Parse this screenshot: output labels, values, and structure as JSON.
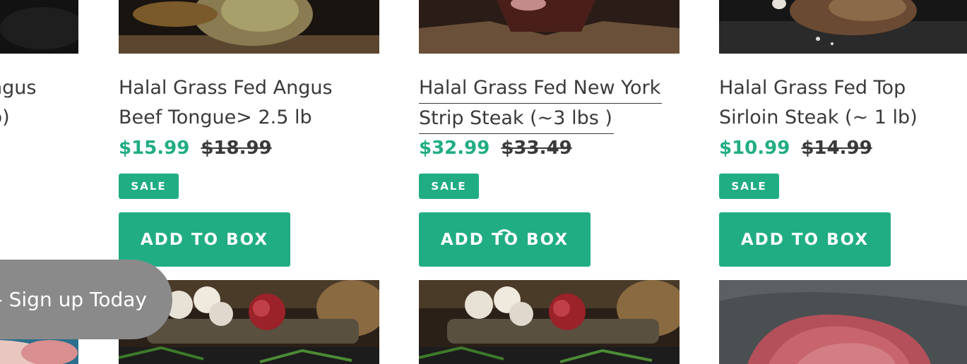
{
  "partial_card": {
    "title_line1": "ngus",
    "title_line2": "b)"
  },
  "cards": [
    {
      "title_line1": "Halal Grass Fed Angus",
      "title_line2": "Beef Tongue> 2.5 lb",
      "price": "$15.99",
      "compare_price": "$18.99",
      "badge": "SALE",
      "button": "ADD TO BOX"
    },
    {
      "title_line1": "Halal Grass Fed New York",
      "title_line2": "Strip Steak (~3 lbs )",
      "price": "$32.99",
      "compare_price": "$33.49",
      "badge": "SALE",
      "button": "ADD TO BOX"
    },
    {
      "title_line1": "Halal Grass Fed Top",
      "title_line2": "Sirloin Steak (~ 1 lb)",
      "price": "$10.99",
      "compare_price": "$14.99",
      "badge": "SALE",
      "button": "ADD TO BOX"
    }
  ],
  "signup_banner": {
    "text": "- Sign up Today"
  },
  "colors": {
    "accent": "#21ad83",
    "text": "#3a3a3a",
    "banner": "#8a8a8a"
  }
}
